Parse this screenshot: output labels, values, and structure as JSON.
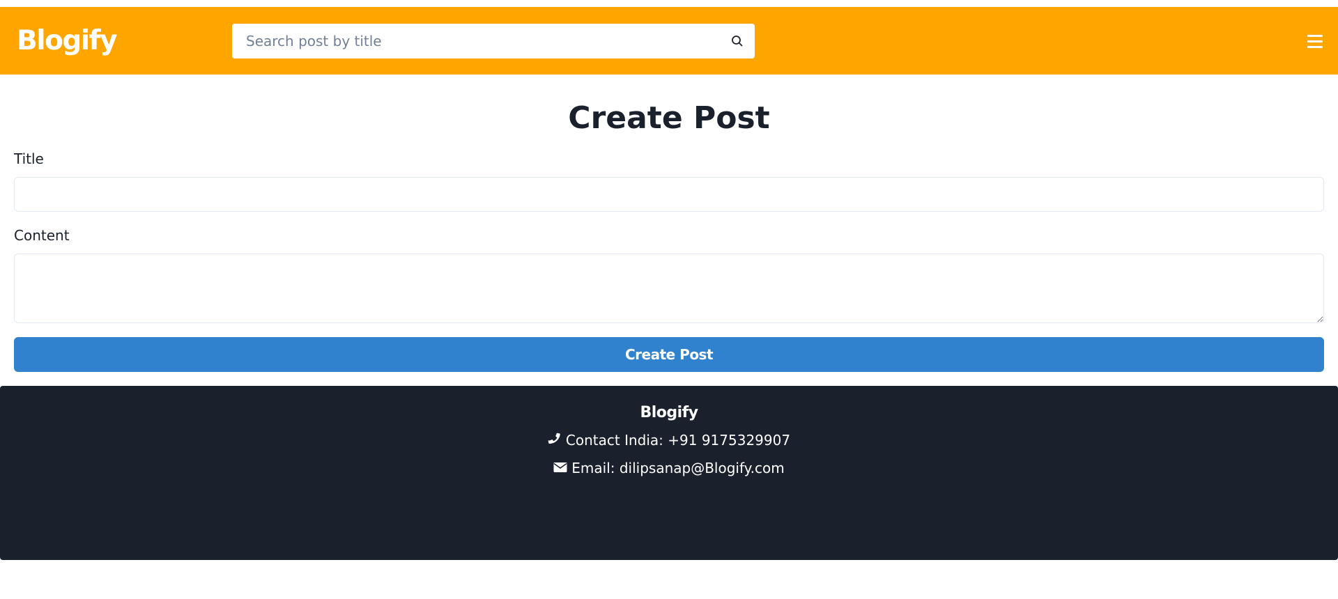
{
  "navbar": {
    "brand": "Blogify",
    "search_placeholder": "Search post by title",
    "background": "#FFA500"
  },
  "main": {
    "title": "Create Post",
    "title_label": "Title",
    "title_value": "",
    "content_label": "Content",
    "content_value": "",
    "submit_label": "Create Post",
    "accent": "#3182CE"
  },
  "footer": {
    "brand": "Blogify",
    "contact": "Contact India: +91 9175329907",
    "email": "Email: dilipsanap@Blogify.com",
    "background": "#1A202C"
  },
  "icons": {
    "search": "search-icon",
    "menu": "hamburger-menu-icon",
    "phone": "phone-icon",
    "email": "envelope-icon"
  }
}
